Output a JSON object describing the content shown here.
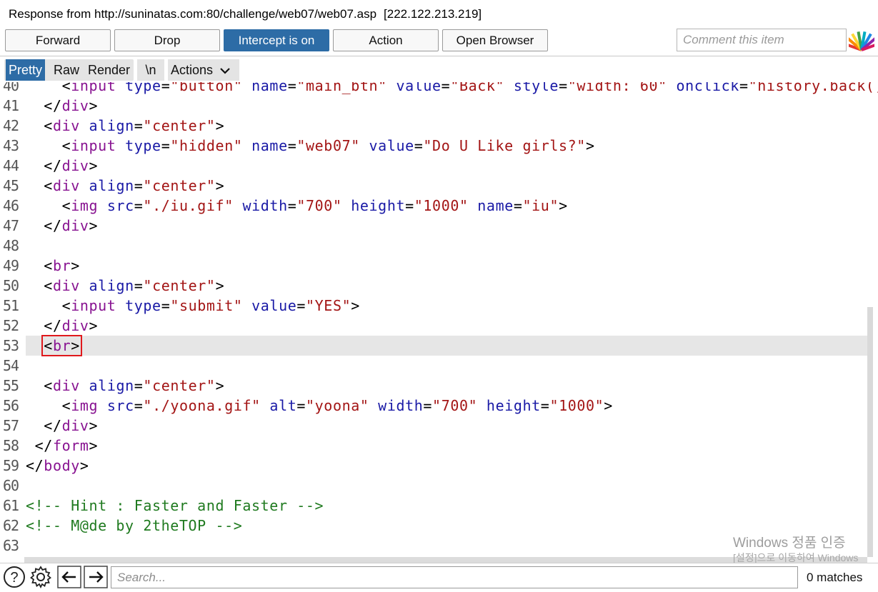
{
  "title_bar": {
    "text": "Response from http://suninatas.com:80/challenge/web07/web07.asp",
    "ip": "[222.122.213.219]"
  },
  "toolbar": {
    "forward": "Forward",
    "drop": "Drop",
    "intercept": "Intercept is on",
    "action": "Action",
    "open_browser": "Open Browser",
    "comment_placeholder": "Comment this item",
    "highlight_icon": "highlight-fan-icon"
  },
  "view_tabs": {
    "pretty": "Pretty",
    "raw": "Raw",
    "render": "Render",
    "newline": "\\n",
    "actions": "Actions"
  },
  "code": {
    "lines": [
      {
        "num": "40",
        "text": "    <input type=\"button\" name=\"main_btn\" value=\"Back\" style=\"width: 60\" onclick=\"history.back()\">"
      },
      {
        "num": "41",
        "text": "  </div>"
      },
      {
        "num": "42",
        "text": "  <div align=\"center\">"
      },
      {
        "num": "43",
        "text": "    <input type=\"hidden\" name=\"web07\" value=\"Do U Like girls?\">"
      },
      {
        "num": "44",
        "text": "  </div>"
      },
      {
        "num": "45",
        "text": "  <div align=\"center\">"
      },
      {
        "num": "46",
        "text": "    <img src=\"./iu.gif\" width=\"700\" height=\"1000\" name=\"iu\">"
      },
      {
        "num": "47",
        "text": "  </div>"
      },
      {
        "num": "48",
        "text": ""
      },
      {
        "num": "49",
        "text": "  <br>"
      },
      {
        "num": "50",
        "text": "  <div align=\"center\">"
      },
      {
        "num": "51",
        "text": "    <input type=\"submit\" value=\"YES\">"
      },
      {
        "num": "52",
        "text": "  </div>"
      },
      {
        "num": "53",
        "text": "  <br>"
      },
      {
        "num": "54",
        "text": ""
      },
      {
        "num": "55",
        "text": "  <div align=\"center\">"
      },
      {
        "num": "56",
        "text": "    <img src=\"./yoona.gif\" alt=\"yoona\" width=\"700\" height=\"1000\">"
      },
      {
        "num": "57",
        "text": "  </div>"
      },
      {
        "num": "58",
        "text": " </form>"
      },
      {
        "num": "59",
        "text": "</body>"
      },
      {
        "num": "60",
        "text": ""
      },
      {
        "num": "61",
        "text": "<!-- Hint : Faster and Faster -->"
      },
      {
        "num": "62",
        "text": "<!-- M@de by 2theTOP -->"
      },
      {
        "num": "63",
        "text": ""
      }
    ],
    "current_line": "53"
  },
  "watermark": {
    "line1": "Windows 정품 인증",
    "line2": "[설정]으로 이동하여 Windows"
  },
  "bottom_bar": {
    "search_placeholder": "Search...",
    "matches": "0 matches"
  },
  "colors": {
    "accent": "#2d6ca6",
    "tag": "#881391",
    "attribute": "#1a1aa6",
    "value": "#a31515",
    "comment": "#1f7a1f",
    "highlight_box": "#e0191c"
  }
}
